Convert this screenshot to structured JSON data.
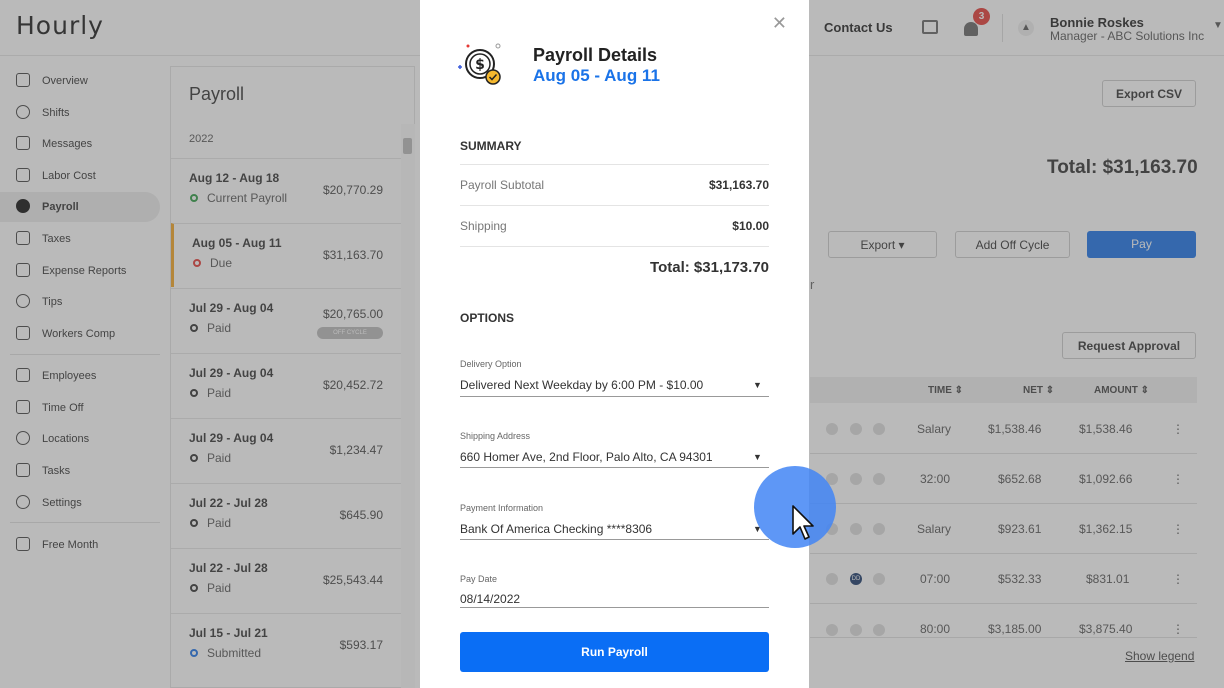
{
  "app": {
    "logo": "Hourly"
  },
  "header": {
    "contact": "Contact Us",
    "notif_count": "3",
    "user_name": "Bonnie Roskes",
    "user_role": "Manager - ABC Solutions Inc"
  },
  "sidebar": {
    "items": [
      {
        "label": "Overview",
        "icon": "home-icon"
      },
      {
        "label": "Shifts",
        "icon": "clock-icon"
      },
      {
        "label": "Messages",
        "icon": "chat-icon"
      },
      {
        "label": "Labor Cost",
        "icon": "bar-chart-icon"
      },
      {
        "label": "Payroll",
        "icon": "dollar-icon"
      },
      {
        "label": "Taxes",
        "icon": "document-icon"
      },
      {
        "label": "Expense Reports",
        "icon": "folder-icon"
      },
      {
        "label": "Tips",
        "icon": "coin-icon"
      },
      {
        "label": "Workers Comp",
        "icon": "shield-icon"
      },
      {
        "label": "Employees",
        "icon": "person-icon"
      },
      {
        "label": "Time Off",
        "icon": "plane-icon"
      },
      {
        "label": "Locations",
        "icon": "pin-icon"
      },
      {
        "label": "Tasks",
        "icon": "list-icon"
      },
      {
        "label": "Settings",
        "icon": "gear-icon"
      },
      {
        "label": "Free Month",
        "icon": "tag-icon"
      }
    ]
  },
  "payroll_list": {
    "title": "Payroll",
    "year": "2022",
    "rows": [
      {
        "dates": "Aug 12 - Aug 18",
        "status": "Current Payroll",
        "amount": "$20,770.29",
        "status_color": "#2e9e44"
      },
      {
        "dates": "Aug 05 - Aug 11",
        "status": "Due",
        "amount": "$31,163.70",
        "status_color": "#e53935"
      },
      {
        "dates": "Jul 29 - Aug 04",
        "status": "Paid",
        "amount": "$20,765.00",
        "badge": "OFF CYCLE",
        "status_color": "#333333"
      },
      {
        "dates": "Jul 29 - Aug 04",
        "status": "Paid",
        "amount": "$20,452.72",
        "status_color": "#333333"
      },
      {
        "dates": "Jul 29 - Aug 04",
        "status": "Paid",
        "amount": "$1,234.47",
        "status_color": "#333333"
      },
      {
        "dates": "Jul 22 - Jul 28",
        "status": "Paid",
        "amount": "$645.90",
        "status_color": "#333333"
      },
      {
        "dates": "Jul 22 - Jul 28",
        "status": "Paid",
        "amount": "$25,543.44",
        "status_color": "#333333"
      },
      {
        "dates": "Jul 15 - Jul 21",
        "status": "Submitted",
        "amount": "$593.17",
        "status_color": "#1a73e8"
      }
    ]
  },
  "main": {
    "export_csv": "Export CSV",
    "total": "Total: $31,163.70",
    "export": "Export",
    "add_off_cycle": "Add Off Cycle",
    "pay": "Pay",
    "request_approval": "Request Approval",
    "partial_text": "r",
    "columns": [
      "TIME",
      "NET",
      "AMOUNT"
    ],
    "rows": [
      {
        "time": "Salary",
        "net": "$1,538.46",
        "amount": "$1,538.46"
      },
      {
        "time": "32:00",
        "net": "$652.68",
        "amount": "$1,092.66"
      },
      {
        "time": "Salary",
        "net": "$923.61",
        "amount": "$1,362.15"
      },
      {
        "time": "07:00",
        "net": "$532.33",
        "amount": "$831.01",
        "dd": "DD"
      },
      {
        "time": "80:00",
        "net": "$3,185.00",
        "amount": "$3,875.40"
      }
    ],
    "show_legend": "Show legend"
  },
  "modal": {
    "title": "Payroll Details",
    "dates": "Aug 05 - Aug 11",
    "summary_heading": "SUMMARY",
    "subtotal_label": "Payroll Subtotal",
    "subtotal_value": "$31,163.70",
    "shipping_label": "Shipping",
    "shipping_value": "$10.00",
    "total": "Total: $31,173.70",
    "options_heading": "OPTIONS",
    "delivery_label": "Delivery Option",
    "delivery_value": "Delivered Next Weekday by 6:00 PM - $10.00",
    "address_label": "Shipping Address",
    "address_value": "660 Homer Ave, 2nd Floor, Palo Alto, CA 94301",
    "payment_label": "Payment Information",
    "payment_value": "Bank Of America Checking ****8306",
    "paydate_label": "Pay Date",
    "paydate_value": "08/14/2022",
    "run_button": "Run Payroll",
    "close_symbol": "✕"
  }
}
